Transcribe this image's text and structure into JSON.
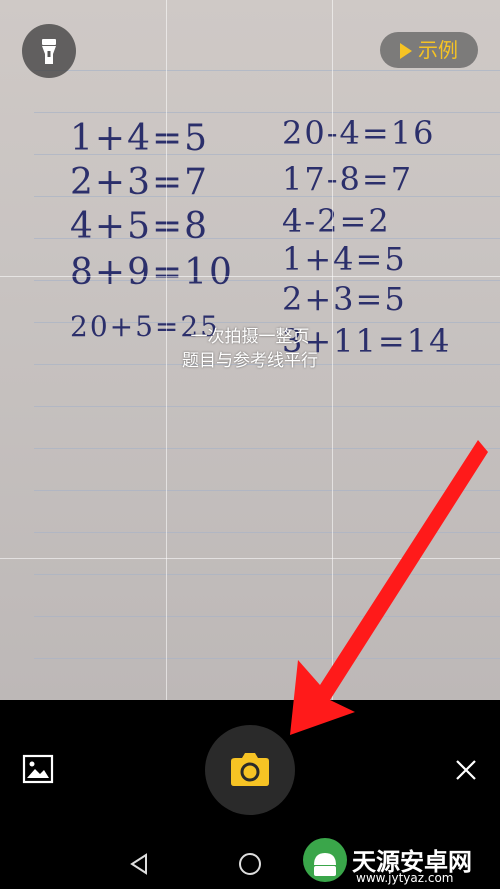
{
  "top_bar": {
    "flash_icon": "flashlight-icon",
    "example_label": "示例",
    "example_icon": "play-triangle-icon"
  },
  "viewfinder": {
    "hint_line1": "一次拍摄一整页",
    "hint_line2": "题目与参考线平行",
    "notebook_left": [
      "1+4=5",
      "2+3=7",
      "4+5=8",
      "8+9=10",
      "20+5=25"
    ],
    "notebook_right": [
      "20-4=16",
      "17-8=7",
      "4-2=2",
      "1+4=5",
      "2+3=5",
      "3+11=14"
    ]
  },
  "bottom_bar": {
    "gallery_icon": "image-gallery-icon",
    "shutter_icon": "camera-icon",
    "close_icon": "close-icon"
  },
  "nav_bar": {
    "back_icon": "back-triangle-icon",
    "home_icon": "home-circle-icon"
  },
  "watermark": {
    "title": "天源安卓网",
    "url": "www.jytyaz.com"
  },
  "colors": {
    "accent": "#f6c324",
    "annotation_arrow": "#ff1a1a",
    "ink": "#2b2f6b"
  }
}
